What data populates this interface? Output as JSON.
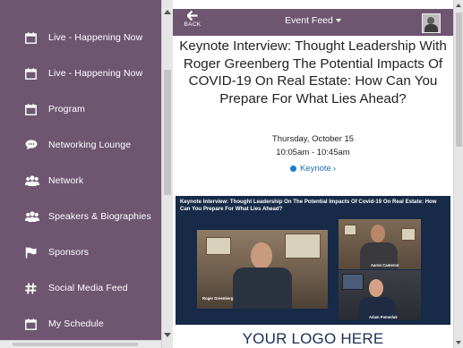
{
  "sidebar": {
    "items": [
      {
        "label": "Live - Happening Now",
        "icon": "calendar-icon"
      },
      {
        "label": "Live - Happening Now",
        "icon": "calendar-icon"
      },
      {
        "label": "Program",
        "icon": "calendar-icon"
      },
      {
        "label": "Networking Lounge",
        "icon": "chat-bubble-icon"
      },
      {
        "label": "Network",
        "icon": "people-icon"
      },
      {
        "label": "Speakers & Biographies",
        "icon": "people-icon"
      },
      {
        "label": "Sponsors",
        "icon": "flag-icon"
      },
      {
        "label": "Social Media Feed",
        "icon": "hashtag-icon"
      },
      {
        "label": "My Schedule",
        "icon": "calendar-icon"
      }
    ]
  },
  "topbar": {
    "back_label": "BACK",
    "title": "Event Feed"
  },
  "session": {
    "title": "Keynote Interview: Thought Leadership With Roger Greenberg The Potential Impacts Of COVID-19 On Real Estate: How Can You Prepare For What Lies Ahead?",
    "date": "Thursday, October 15",
    "time": "10:05am - 10:45am",
    "track": "Keynote"
  },
  "banner": {
    "title": "Keynote Interview: Thought Leadership On The Potential Impacts Of Covid-19 On Real Estate: How Can You Prepare For What Lies Ahead?",
    "speakers": [
      "Roger Greenberg",
      "Aaron Cameron",
      "Adam Pomeduk"
    ]
  },
  "logo_text": "YOUR LOGO HERE",
  "colors": {
    "sidebar": "#6e5671",
    "topbar": "#6e5671",
    "link": "#1e6fb5",
    "banner": "#172a47"
  }
}
